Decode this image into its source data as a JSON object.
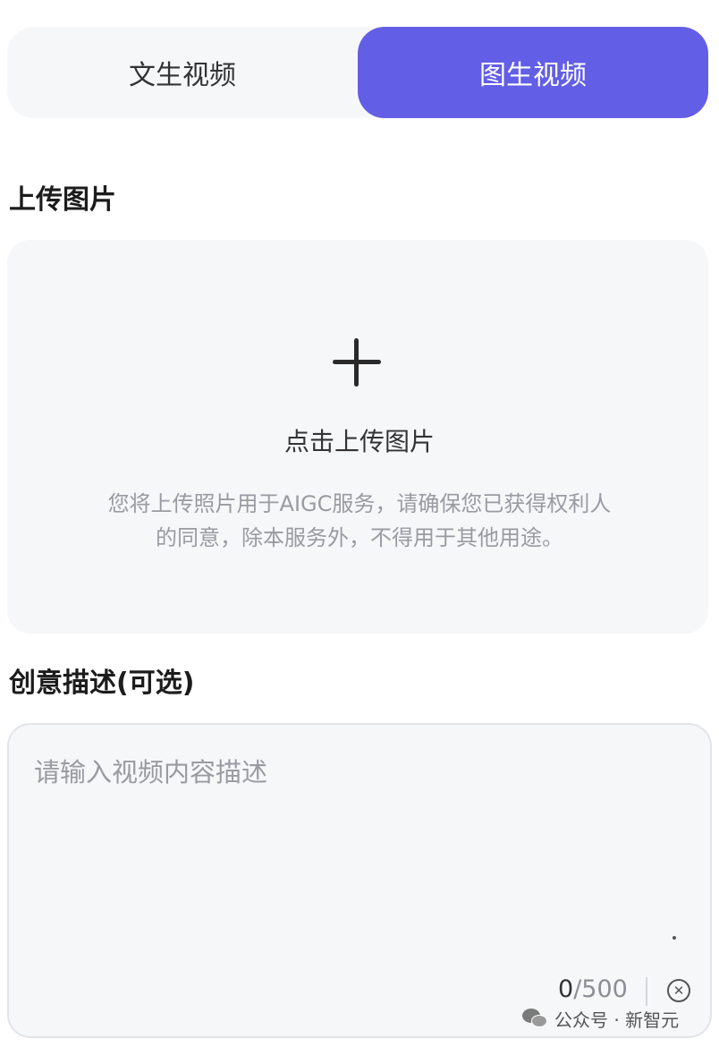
{
  "tabs": [
    {
      "label": "文生视频",
      "active": false
    },
    {
      "label": "图生视频",
      "active": true
    }
  ],
  "colors": {
    "accent": "#625ee6",
    "panel": "#f6f7f9"
  },
  "upload": {
    "section_title": "上传图片",
    "icon": "plus-icon",
    "label": "点击上传图片",
    "note_line1": "您将上传照片用于AIGC服务，请确保您已获得权利人",
    "note_line2": "的同意，除本服务外，不得用于其他用途。"
  },
  "description": {
    "section_title": "创意描述(可选)",
    "placeholder": "请输入视频内容描述",
    "value": "",
    "count_current": "0",
    "count_max": "/500",
    "clear_icon": "circle-x-icon"
  },
  "watermark": {
    "text": "公众号 · 新智元",
    "icon": "wechat-icon"
  }
}
